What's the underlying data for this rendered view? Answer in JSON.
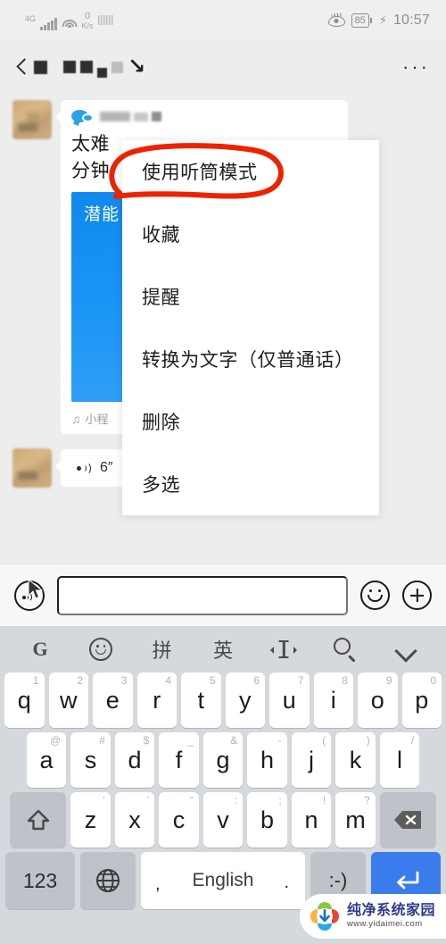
{
  "status_bar": {
    "network_type": "4G",
    "data_rate_value": "0",
    "data_rate_unit": "K/s",
    "battery_percent": "85",
    "time": "10:57",
    "icons": [
      "signal-bars-icon",
      "wifi-icon",
      "keyboard-icon",
      "eye-care-icon",
      "battery-icon",
      "charging-bolt-icon"
    ]
  },
  "nav_bar": {
    "back_label": "back-arrow",
    "title_redacted": true,
    "more_label": "···"
  },
  "chat": {
    "message_card": {
      "source_app": "wechat-channels-icon",
      "sender_redacted": true,
      "title_line1": "太难",
      "title_line2": "分钟",
      "image_overlay_text": "潜能",
      "footer_icon": "mini-program-icon",
      "footer_label": "小程"
    },
    "voice_message": {
      "icon": "speaker-icon",
      "duration": "6″",
      "unread": true
    }
  },
  "context_menu": {
    "items": [
      {
        "label": "使用听筒模式",
        "highlighted": true
      },
      {
        "label": "收藏",
        "highlighted": false
      },
      {
        "label": "提醒",
        "highlighted": false
      },
      {
        "label": "转换为文字（仅普通话）",
        "highlighted": false
      },
      {
        "label": "删除",
        "highlighted": false
      },
      {
        "label": "多选",
        "highlighted": false
      }
    ],
    "annotation_color": "#ee2200"
  },
  "input_bar": {
    "voice_button": "voice-input-icon",
    "text_value": "",
    "text_placeholder": "",
    "emoji_button": "emoji-icon",
    "plus_button": "plus-icon"
  },
  "keyboard": {
    "toolbar": [
      {
        "name": "google-icon",
        "label": "G"
      },
      {
        "name": "emoji-icon",
        "label": ""
      },
      {
        "name": "pinyin-mode",
        "label": "拼"
      },
      {
        "name": "english-mode",
        "label": "英"
      },
      {
        "name": "cursor-move-icon",
        "label": ""
      },
      {
        "name": "search-icon",
        "label": ""
      },
      {
        "name": "collapse-keyboard-icon",
        "label": ""
      }
    ],
    "row1": [
      {
        "key": "q",
        "sup": "1"
      },
      {
        "key": "w",
        "sup": "2"
      },
      {
        "key": "e",
        "sup": "3"
      },
      {
        "key": "r",
        "sup": "4"
      },
      {
        "key": "t",
        "sup": "5"
      },
      {
        "key": "y",
        "sup": "6"
      },
      {
        "key": "u",
        "sup": "7"
      },
      {
        "key": "i",
        "sup": "8"
      },
      {
        "key": "o",
        "sup": "9"
      },
      {
        "key": "p",
        "sup": "0"
      }
    ],
    "row2": [
      {
        "key": "a",
        "sup": "@"
      },
      {
        "key": "s",
        "sup": "#"
      },
      {
        "key": "d",
        "sup": "$"
      },
      {
        "key": "f",
        "sup": "_"
      },
      {
        "key": "g",
        "sup": "&"
      },
      {
        "key": "h",
        "sup": "-"
      },
      {
        "key": "j",
        "sup": "("
      },
      {
        "key": "k",
        "sup": ")"
      },
      {
        "key": "l",
        "sup": "/"
      }
    ],
    "row3": [
      {
        "key": "z",
        "sup": "‘"
      },
      {
        "key": "x",
        "sup": "’"
      },
      {
        "key": "c",
        "sup": "“"
      },
      {
        "key": "v",
        "sup": ":"
      },
      {
        "key": "b",
        "sup": ";"
      },
      {
        "key": "n",
        "sup": "!"
      },
      {
        "key": "m",
        "sup": "?"
      }
    ],
    "shift_key": "shift-icon",
    "backspace_key": "backspace-icon",
    "numeric_key": "123",
    "globe_key": "globe-icon",
    "space_key": "English",
    "space_comma": ",",
    "space_period": ".",
    "smiley_key": ":-)",
    "enter_key": "enter-icon"
  },
  "watermark": {
    "title": "纯净系统家园",
    "url": "www.yidaimei.com"
  }
}
